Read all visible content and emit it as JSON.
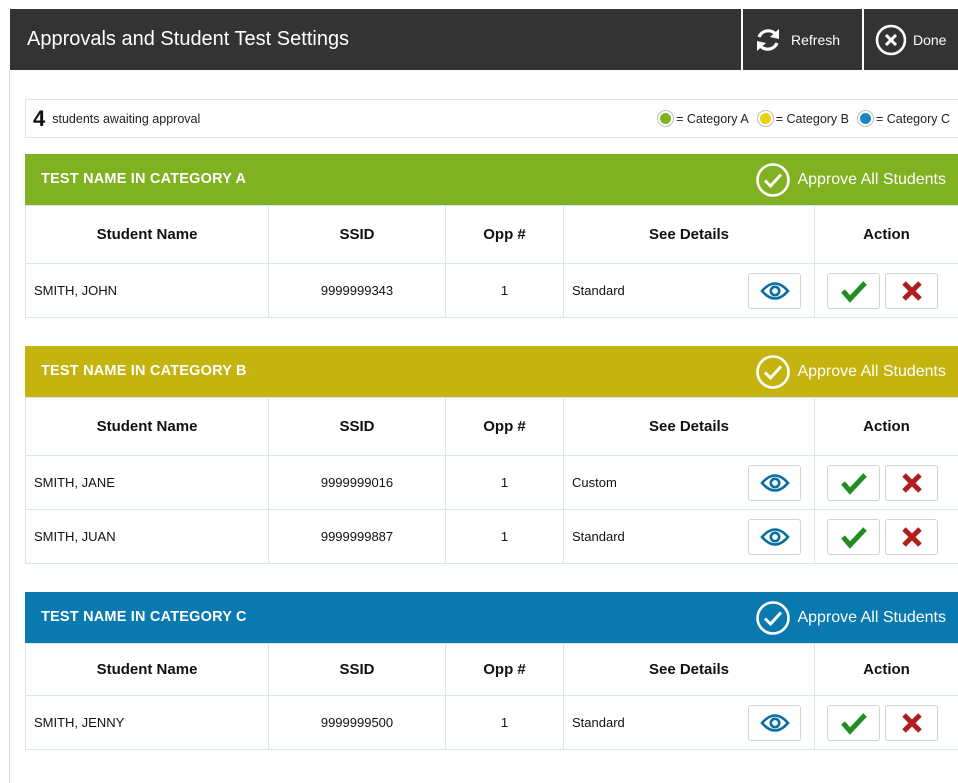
{
  "header": {
    "title": "Approvals and Student Test Settings",
    "refresh_label": "Refresh",
    "done_label": "Done"
  },
  "summary": {
    "count": "4",
    "text": "students awaiting approval"
  },
  "legend": [
    {
      "label": "= Category A",
      "color": "#80b31f"
    },
    {
      "label": "= Category B",
      "color": "#e9d20f"
    },
    {
      "label": "= Category C",
      "color": "#1b86c6"
    }
  ],
  "columns": {
    "student_name": "Student Name",
    "ssid": "SSID",
    "opp": "Opp #",
    "details": "See Details",
    "action": "Action"
  },
  "approve_all_label": "Approve All Students",
  "sections": [
    {
      "title": "TEST NAME IN CATEGORY A",
      "color": "#7fb120",
      "rows": [
        {
          "name": "SMITH, JOHN",
          "ssid": "9999999343",
          "opp": "1",
          "details": "Standard"
        }
      ]
    },
    {
      "title": "TEST NAME IN CATEGORY B",
      "color": "#c5b40f",
      "rows": [
        {
          "name": "SMITH, JANE",
          "ssid": "9999999016",
          "opp": "1",
          "details": "Custom"
        },
        {
          "name": "SMITH, JUAN",
          "ssid": "9999999887",
          "opp": "1",
          "details": "Standard"
        }
      ]
    },
    {
      "title": "TEST NAME IN CATEGORY C",
      "color": "#0a79b0",
      "rows": [
        {
          "name": "SMITH, JENNY",
          "ssid": "9999999500",
          "opp": "1",
          "details": "Standard"
        }
      ]
    }
  ],
  "icons": {
    "refresh": "refresh-icon",
    "done": "close-circle-icon",
    "approve_all": "check-circle-icon",
    "details": "eye-icon",
    "approve": "checkmark-icon",
    "deny": "x-icon"
  },
  "colors": {
    "titlebar": "#333333",
    "approve_green": "#228b22",
    "deny_red": "#b01e1e",
    "eye_blue": "#0a6fa0"
  }
}
